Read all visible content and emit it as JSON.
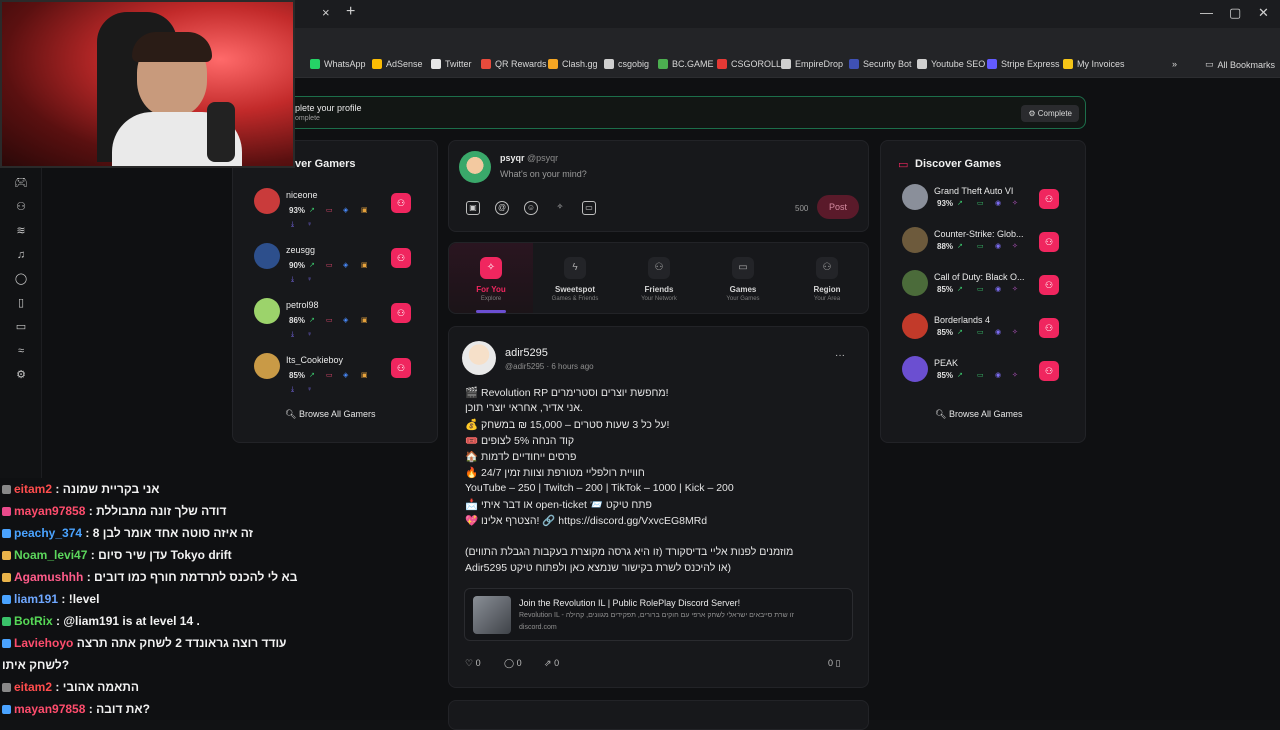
{
  "browser": {
    "tab_close": "×",
    "tab_new": "+",
    "bookmarks": [
      {
        "label": "WhatsApp",
        "color": "#25d366"
      },
      {
        "label": "AdSense",
        "color": "#fbbc04"
      },
      {
        "label": "Twitter",
        "color": "#e7e7e7"
      },
      {
        "label": "QR Rewards",
        "color": "#e84b3c"
      },
      {
        "label": "Clash.gg",
        "color": "#f5a623"
      },
      {
        "label": "csgobig",
        "color": "#cfcfcf"
      },
      {
        "label": "BC.GAME",
        "color": "#4caf50"
      },
      {
        "label": "CSGOROLL",
        "color": "#e53935"
      },
      {
        "label": "EmpireDrop",
        "color": "#cfcfcf"
      },
      {
        "label": "Security Bot",
        "color": "#3f51b5"
      },
      {
        "label": "Youtube SEO",
        "color": "#cfcfcf"
      },
      {
        "label": "Stripe Express",
        "color": "#635bff"
      },
      {
        "label": "My Invoices",
        "color": "#f5c518"
      }
    ],
    "overflow": "»",
    "all_bookmarks": "All Bookmarks"
  },
  "profile_banner": {
    "title": "plete your profile",
    "subtitle": "omplete",
    "button": "Complete"
  },
  "discover_gamers": {
    "title": "ver Gamers",
    "items": [
      {
        "name": "niceone",
        "pct": "93%"
      },
      {
        "name": "zeusgg",
        "pct": "90%"
      },
      {
        "name": "petrol98",
        "pct": "86%"
      },
      {
        "name": "Its_Cookieboy",
        "pct": "85%"
      }
    ],
    "browse": "Browse All Gamers"
  },
  "composer": {
    "name": "psyqr",
    "handle": "@psyqr",
    "prompt": "What's on your mind?",
    "char_count": "500",
    "post_button": "Post"
  },
  "feed_tabs": [
    {
      "label": "For You",
      "sub": "Explore",
      "active": true
    },
    {
      "label": "Sweetspot",
      "sub": "Games & Friends"
    },
    {
      "label": "Friends",
      "sub": "Your Network"
    },
    {
      "label": "Games",
      "sub": "Your Games"
    },
    {
      "label": "Region",
      "sub": "Your Area"
    }
  ],
  "post": {
    "author": "adir5295",
    "meta": "@adir5295 · 6 hours ago",
    "more": "···",
    "lines": [
      "🎬 Revolution RP מחפשת יוצרים וסטרימרים!",
      "אני אדיר, אחראי יוצרי תוכן.",
      "💰 על כל 3 שעות סטרים – 15,000 ₪ במשחק!",
      "🎟️ קוד הנחה 5% לצופים",
      "🏠 פרסים ייחודיים לדמות",
      "🔥 חוויית רולפליי מטורפת וצוות זמין 24/7",
      "YouTube – 250 | Twitch – 200 | TikTok – 1000 | Kick – 200",
      "📩 או דבר איתי open-ticket 📨 פתח טיקט",
      "💖 הצטרף אלינו! 🔗 https://discord.gg/VxvcEG8MRd",
      "(מוזמנים לפנות אליי בדיסקורד (זו היא גרסה מקוצרת בעקבות הגבלת התווים",
      "Adir5295 או להיכנס לשרת בקישור שנמצא כאן ולפתוח טיקט)"
    ],
    "embed": {
      "title": "Join the Revolution IL | Public RolePlay Discord Server!",
      "description": "Revolution IL - זו שרת סייבאים ישראלי לשחק ארפי עם חוקים ברורים, תפקידים מגוונים, קהילה",
      "domain": "discord.com"
    },
    "likes": "0",
    "comments": "0",
    "shares": "0",
    "saves": "0"
  },
  "discover_games": {
    "title": "Discover Games",
    "items": [
      {
        "name": "Grand Theft Auto VI",
        "pct": "93%"
      },
      {
        "name": "Counter-Strike: Glob...",
        "pct": "88%"
      },
      {
        "name": "Call of Duty: Black O...",
        "pct": "85%"
      },
      {
        "name": "Borderlands 4",
        "pct": "85%"
      },
      {
        "name": "PEAK",
        "pct": "85%"
      }
    ],
    "browse": "Browse All Games"
  },
  "chat": [
    {
      "user": "eitam2",
      "color": "#ff4d4d",
      "msg": ": אני בקריית שמונה"
    },
    {
      "user": "mayan97858",
      "color": "#ff4d6d",
      "msg": ": דודה שלך זונה מתבוללת"
    },
    {
      "user": "peachy_374",
      "color": "#4aa3ff",
      "msg": ": זה איזה סוטה אחד אומר לבן 8"
    },
    {
      "user": "Noam_levi47",
      "color": "#5cd65c",
      "msg": ": עדן שיר סיום Tokyo drift"
    },
    {
      "user": "Agamushhh",
      "color": "#ff5c8a",
      "msg": ": בא לי להכנס לתרדמת חורף כמו דובים"
    },
    {
      "user": "liam191",
      "color": "#6fa8ff",
      "msg": ": !level"
    },
    {
      "user": "BotRix",
      "color": "#57d957",
      "msg": ": @liam191 is at level 14 ."
    },
    {
      "user": "Laviehoyo",
      "color": "#ff4d6d",
      "msg": "עודד רוצה גראונדד 2 לשחק אתה תרצה"
    },
    {
      "user": "",
      "color": "#ffffff",
      "msg": "לשחק איתו?"
    },
    {
      "user": "eitam2",
      "color": "#ff4d4d",
      "msg": ": התאמה אהובי"
    },
    {
      "user": "mayan97858",
      "color": "#ff4d6d",
      "msg": ": את דובה?"
    }
  ],
  "colors": {
    "accent": "#f0265f",
    "banner_border": "#1c6e4a"
  }
}
